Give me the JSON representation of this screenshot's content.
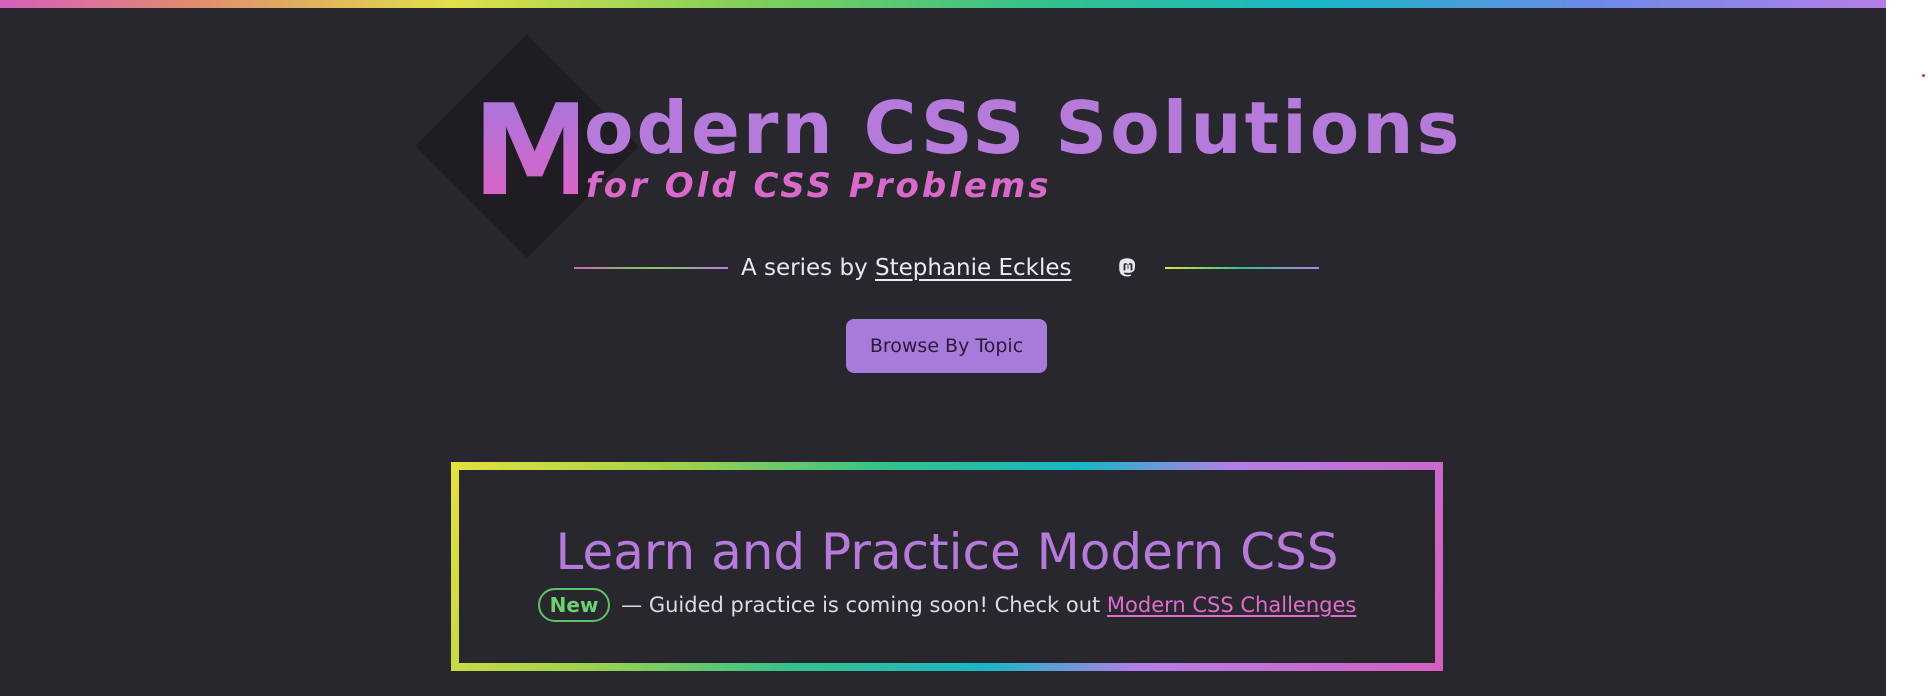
{
  "colors": {
    "page_background": "#28272d",
    "accent_purple": "#b57ada",
    "accent_pink": "#d96acb",
    "button_background": "#a77bda",
    "new_badge_green": "#5cc465"
  },
  "header": {
    "logo_letter": "M",
    "title_rest": "odern CSS Solutions",
    "subtitle": "for Old CSS Problems"
  },
  "byline": {
    "prefix": "A series by",
    "author": "Stephanie Eckles",
    "social_icon": "mastodon-icon"
  },
  "browse_button": {
    "label": "Browse By Topic"
  },
  "promo": {
    "title": "Learn and Practice Modern CSS",
    "badge": "New",
    "message": "— Guided practice is coming soon! Check out",
    "link_text": "Modern CSS Challenges"
  }
}
